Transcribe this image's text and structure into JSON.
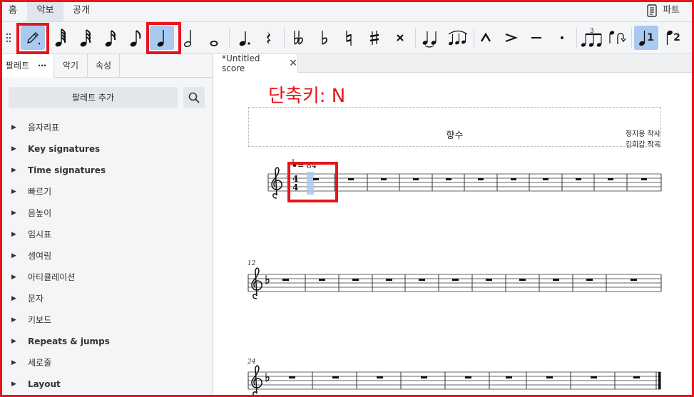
{
  "menu": {
    "tabs": [
      {
        "label": "홈",
        "active": false
      },
      {
        "label": "악보",
        "active": true
      },
      {
        "label": "공개",
        "active": false
      }
    ],
    "parts_label": "파트"
  },
  "toolbar": {
    "voice_labels": [
      "1",
      "2"
    ],
    "tuplet_number": "3"
  },
  "panel": {
    "tabs": [
      "팔레트",
      "악기",
      "속성"
    ],
    "more_glyph": "⋯",
    "add_palette_label": "팔레트 추가",
    "items": [
      {
        "label": "음자리표",
        "bold": false
      },
      {
        "label": "Key signatures",
        "bold": true
      },
      {
        "label": "Time signatures",
        "bold": true
      },
      {
        "label": "빠르기",
        "bold": false
      },
      {
        "label": "음높이",
        "bold": false
      },
      {
        "label": "임시표",
        "bold": false
      },
      {
        "label": "셈여림",
        "bold": false
      },
      {
        "label": "아티큘레이션",
        "bold": false
      },
      {
        "label": "문자",
        "bold": false
      },
      {
        "label": "키보드",
        "bold": false
      },
      {
        "label": "Repeats & jumps",
        "bold": true
      },
      {
        "label": "세로줄",
        "bold": false
      },
      {
        "label": "Layout",
        "bold": true
      }
    ]
  },
  "score": {
    "tab_label": "*Untitled score",
    "shortcut_note": "단축키: N",
    "title": "향수",
    "lyricist": "정지용 작사",
    "composer": "김희갑 작곡",
    "time_signature": {
      "numerator": "4",
      "denominator": "4"
    },
    "tempo_fragment": "= 84",
    "system_measure_numbers": [
      "12",
      "24"
    ]
  },
  "colors": {
    "annotation_red": "#e8141b",
    "selection_blue": "#a9c9ee",
    "panel_bg": "#f4f5f7"
  }
}
